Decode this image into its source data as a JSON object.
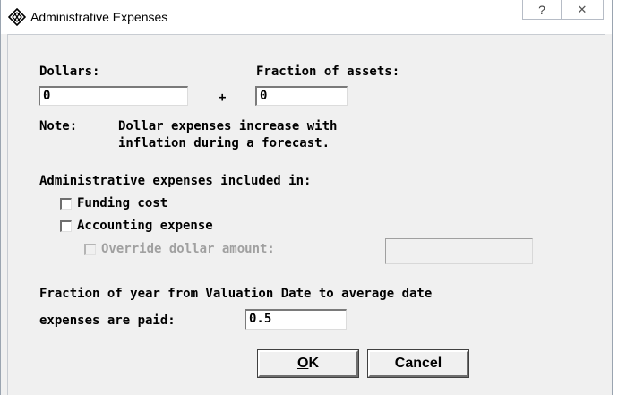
{
  "window": {
    "title": "Administrative Expenses",
    "help_glyph": "?",
    "close_glyph": "✕"
  },
  "form": {
    "dollars_label": "Dollars:",
    "dollars_value": "0",
    "plus_sign": "+",
    "fraction_label": "Fraction of assets:",
    "fraction_value": "0",
    "note_label": "Note:",
    "note_line1": "Dollar expenses increase with",
    "note_line2": "inflation during a forecast.",
    "included_heading": "Administrative expenses included in:",
    "funding_cost_label": "Funding cost",
    "funding_cost_checked": false,
    "accounting_expense_label": "Accounting expense",
    "accounting_expense_checked": false,
    "override_label": "Override dollar amount:",
    "override_checked": false,
    "override_enabled": false,
    "override_value": "",
    "fraction_year_line1": "Fraction of year from Valuation Date to average date",
    "fraction_year_line2": "expenses are paid:",
    "fraction_year_value": "0.5"
  },
  "buttons": {
    "ok_mnemonic": "O",
    "ok_rest": "K",
    "cancel": "Cancel"
  }
}
